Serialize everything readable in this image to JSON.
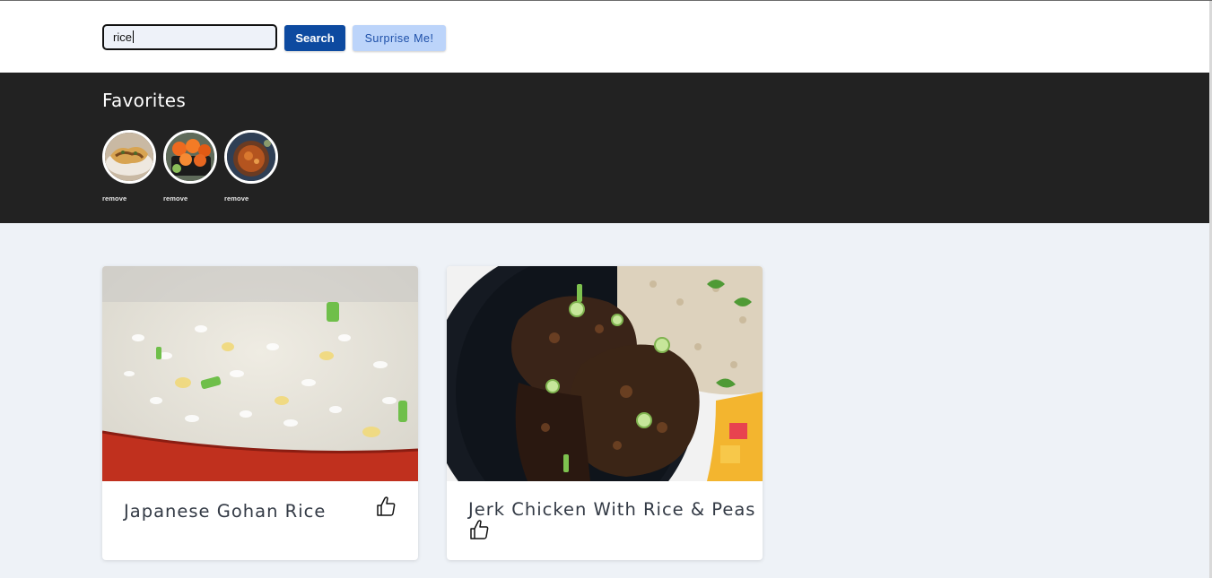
{
  "search": {
    "value": "rice",
    "button_label": "Search",
    "surprise_label": "Surprise Me!"
  },
  "favorites": {
    "title": "Favorites",
    "items": [
      {
        "remove_label": "remove",
        "image": "favorite-dish-1"
      },
      {
        "remove_label": "remove",
        "image": "favorite-dish-2"
      },
      {
        "remove_label": "remove",
        "image": "favorite-dish-3"
      }
    ]
  },
  "recipes": [
    {
      "title": "Japanese Gohan Rice",
      "icon": "thumbs-up-icon"
    },
    {
      "title": "Jerk Chicken With Rice & Peas",
      "icon": "thumbs-up-icon"
    }
  ],
  "colors": {
    "search_button": "#0d4aa0",
    "surprise_button": "#bcd4fa",
    "favorites_bg": "#222222",
    "page_bg": "#eef2f7"
  }
}
